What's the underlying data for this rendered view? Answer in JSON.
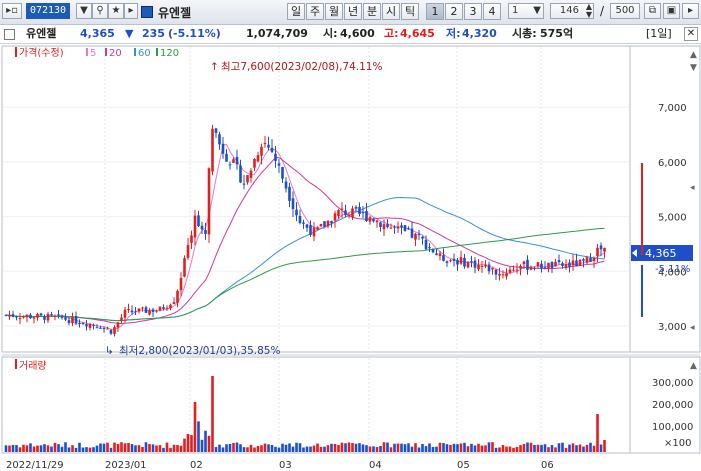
{
  "toolbar": {
    "code": "072130",
    "stock_name": "유엔젤",
    "periods": [
      "일",
      "주",
      "월",
      "년",
      "분",
      "시",
      "틱"
    ],
    "numbers": [
      "1",
      "2",
      "3",
      "4"
    ],
    "minute_value": "1",
    "count_value": "146",
    "divider": "/",
    "total_value": "500"
  },
  "info": {
    "name": "유엔젤",
    "price": "4,365",
    "change_arrow": "▼",
    "change": "235",
    "change_pct": "(-5.11%)",
    "volume": "1,074,709",
    "open_label": "시:",
    "open": "4,600",
    "high_label": "고:",
    "high": "4,645",
    "low_label": "저:",
    "low": "4,320",
    "mcap_label": "시총:",
    "mcap": "575억",
    "timeframe": "[1일]"
  },
  "legend": {
    "price": "가격(수정)",
    "ma": [
      "5",
      "20",
      "60",
      "120"
    ],
    "volume": "거래량"
  },
  "annotations": {
    "high": "최고7,600(2023/02/08),74.11%",
    "low": "최저2,800(2023/01/03),35.85%"
  },
  "price_axis": {
    "ticks": [
      "7,000",
      "6,000",
      "5,000",
      "4,000",
      "3,000"
    ],
    "current": "4,365",
    "current_pct": "-5.11%"
  },
  "volume_axis": {
    "ticks": [
      "300,000",
      "200,000",
      "100,000"
    ],
    "unit": "×100"
  },
  "x_axis": {
    "labels": [
      "2022/11/29",
      "2023/01",
      "02",
      "03",
      "04",
      "05",
      "06"
    ]
  },
  "colors": {
    "up": "#e02020",
    "down": "#1f4fc8",
    "ma5": "#e37ad4",
    "ma20": "#cc3b9a",
    "ma60": "#3a8fd2",
    "ma120": "#2f9a4a",
    "accent": "#1e5bb8"
  },
  "chart_data": {
    "type": "candlestick",
    "x": [
      "2022/11/29",
      "2023/01",
      "02",
      "03",
      "04",
      "05",
      "06"
    ],
    "ylim": [
      2700,
      7800
    ],
    "series": [
      {
        "name": "가격(수정)",
        "values": [
          3200,
          3100,
          3050,
          2950,
          3400,
          3300,
          4200,
          6700,
          6200,
          5600,
          4900,
          4700,
          5000,
          4900,
          4400,
          4150,
          4050,
          4000,
          4100,
          4050,
          4365
        ]
      }
    ],
    "high": 7600,
    "low": 2800,
    "close": 4365
  }
}
